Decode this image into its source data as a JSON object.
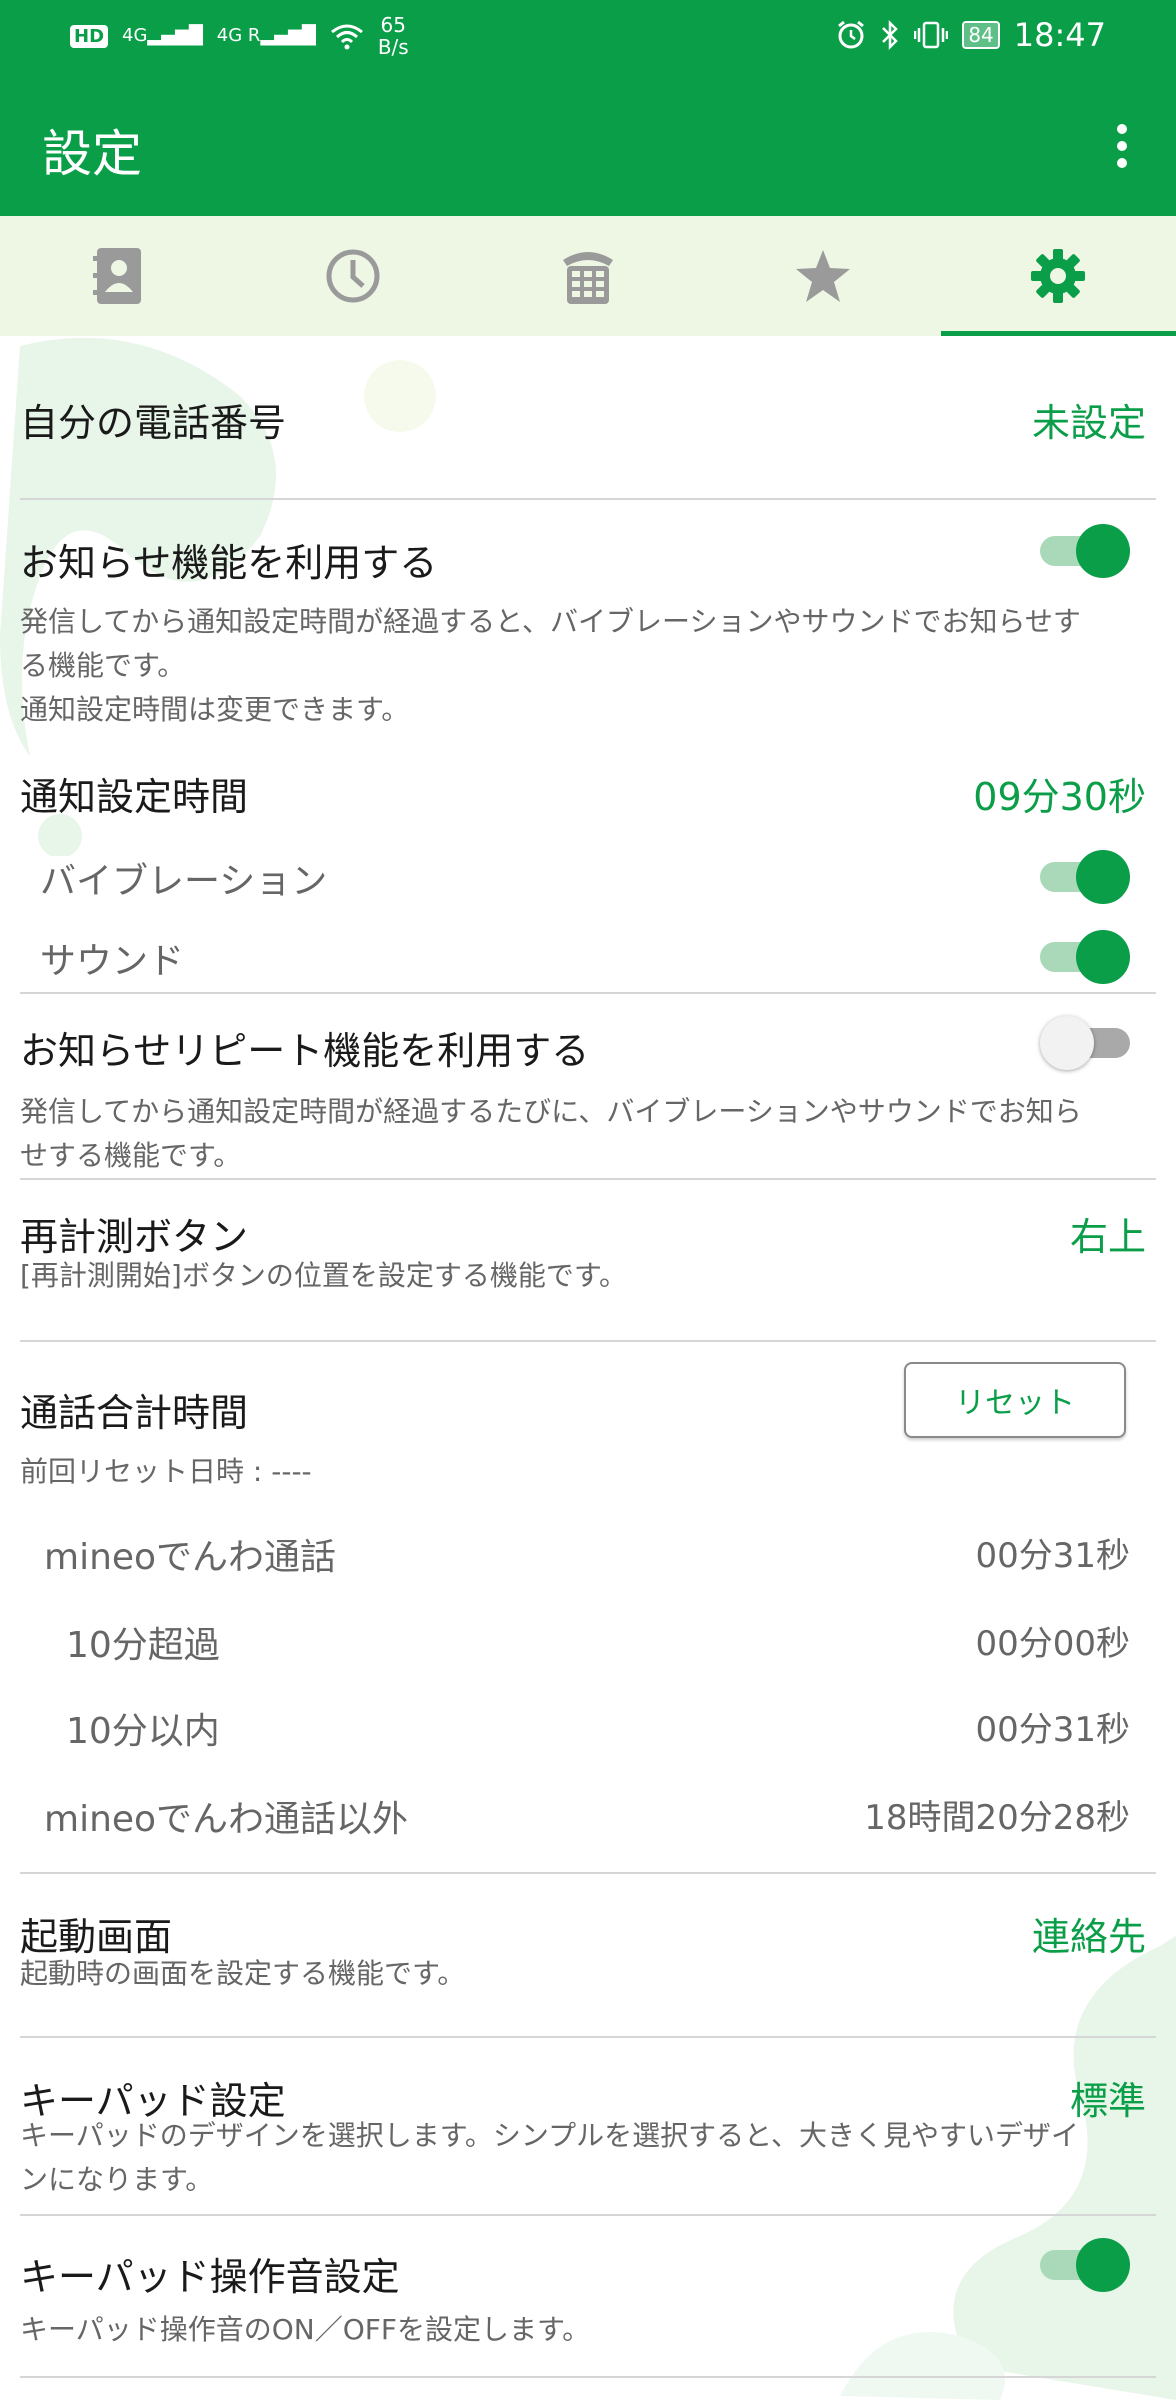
{
  "status_bar": {
    "hd_label": "HD",
    "signal1": "4G",
    "signal2": "4G R",
    "net_speed_value": "65",
    "net_speed_unit": "B/s",
    "battery": "84",
    "time": "18:47"
  },
  "app_bar": {
    "title": "設定",
    "menu_icon": "more-vert-icon"
  },
  "tabs": [
    {
      "icon": "contacts-icon",
      "active": false
    },
    {
      "icon": "clock-icon",
      "active": false
    },
    {
      "icon": "dialpad-icon",
      "active": false
    },
    {
      "icon": "star-icon",
      "active": false
    },
    {
      "icon": "settings-icon",
      "active": true
    }
  ],
  "settings": {
    "my_number": {
      "label": "自分の電話番号",
      "value": "未設定"
    },
    "notify": {
      "label": "お知らせ機能を利用する",
      "enabled": true,
      "desc_line1": "発信してから通知設定時間が経過すると、バイブレーションやサウンドでお知らせす",
      "desc_line2": "る機能です。",
      "desc_line3": "通知設定時間は変更できます。"
    },
    "notify_time": {
      "label": "通知設定時間",
      "value": "09分30秒"
    },
    "vibration": {
      "label": "バイブレーション",
      "enabled": true
    },
    "sound": {
      "label": "サウンド",
      "enabled": true
    },
    "repeat": {
      "label": "お知らせリピート機能を利用する",
      "enabled": false,
      "desc_line1": "発信してから通知設定時間が経過するたびに、バイブレーションやサウンドでお知ら",
      "desc_line2": "せする機能です。"
    },
    "remeasure": {
      "label": "再計測ボタン",
      "value": "右上",
      "desc": "[再計測開始]ボタンの位置を設定する機能です。"
    },
    "total_time": {
      "label": "通話合計時間",
      "reset_button": "リセット",
      "last_reset": "前回リセット日時 : ----",
      "mineo_call": {
        "label": "mineoでんわ通話",
        "value": "00分31秒"
      },
      "over10": {
        "label": "10分超過",
        "value": "00分00秒"
      },
      "within10": {
        "label": "10分以内",
        "value": "00分31秒"
      },
      "other": {
        "label": "mineoでんわ通話以外",
        "value": "18時間20分28秒"
      }
    },
    "startup": {
      "label": "起動画面",
      "value": "連絡先",
      "desc": "起動時の画面を設定する機能です。"
    },
    "keypad": {
      "label": "キーパッド設定",
      "value": "標準",
      "desc_line1": "キーパッドのデザインを選択します。シンプルを選択すると、大きく見やすいデザイ",
      "desc_line2": "ンになります。"
    },
    "keypad_sound": {
      "label": "キーパッド操作音設定",
      "enabled": true,
      "desc": "キーパッド操作音のON／OFFを設定します。"
    }
  },
  "colors": {
    "primary": "#0a9e48",
    "tab_bg": "#edf7e4",
    "divider": "#d6d6d6",
    "secondary_text": "#666666"
  }
}
